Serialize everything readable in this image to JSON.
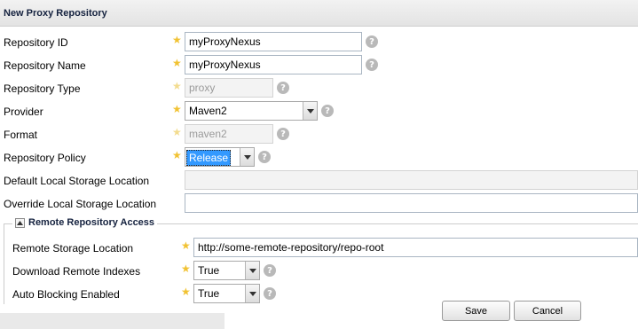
{
  "window": {
    "title": "New Proxy Repository"
  },
  "fields": {
    "repository_id": {
      "label": "Repository ID",
      "value": "myProxyNexus"
    },
    "repository_name": {
      "label": "Repository Name",
      "value": "myProxyNexus"
    },
    "repository_type": {
      "label": "Repository Type",
      "value": "proxy"
    },
    "provider": {
      "label": "Provider",
      "value": "Maven2"
    },
    "format": {
      "label": "Format",
      "value": "maven2"
    },
    "repository_policy": {
      "label": "Repository Policy",
      "value": "Release"
    },
    "default_local_storage": {
      "label": "Default Local Storage Location",
      "value": ""
    },
    "override_local_storage": {
      "label": "Override Local Storage Location",
      "value": ""
    }
  },
  "remote_section": {
    "legend": "Remote Repository Access",
    "remote_storage_location": {
      "label": "Remote Storage Location",
      "value": "http://some-remote-repository/repo-root"
    },
    "download_remote_indexes": {
      "label": "Download Remote Indexes",
      "value": "True"
    },
    "auto_blocking_enabled": {
      "label": "Auto Blocking Enabled",
      "value": "True"
    }
  },
  "buttons": {
    "save": "Save",
    "cancel": "Cancel"
  },
  "glyphs": {
    "required": "★",
    "help": "?",
    "collapse": "▲",
    "dropdown": "▼"
  },
  "colors": {
    "required_star": "#f1c232",
    "selection": "#3399ff",
    "help_icon": "#b9b9b9"
  }
}
